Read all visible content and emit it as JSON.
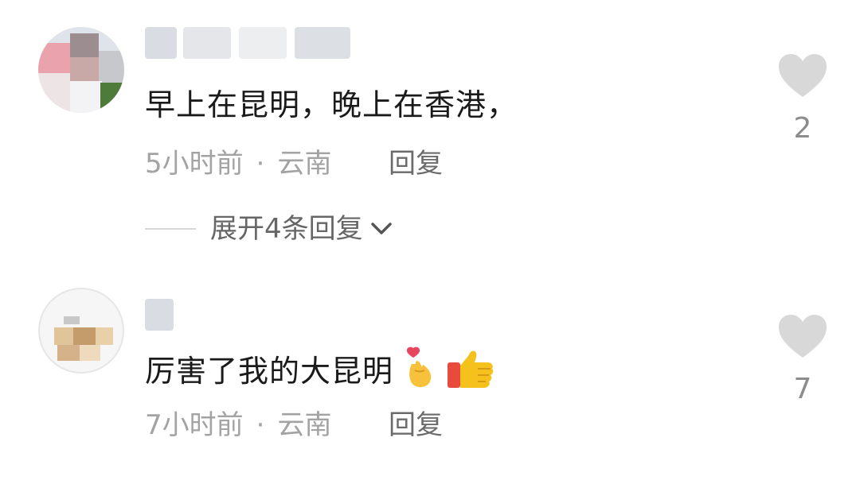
{
  "comments": [
    {
      "username": "",
      "text": "早上在昆明，晚上在香港，",
      "time": "5小时前",
      "location": "云南",
      "reply_label": "回复",
      "likes": "2",
      "expand_label": "展开4条回复"
    },
    {
      "username": "",
      "text": "厉害了我的大昆明",
      "emojis": [
        "finger-heart-emoji",
        "thumbs-up-emoji"
      ],
      "time": "7小时前",
      "location": "云南",
      "reply_label": "回复",
      "likes": "7"
    }
  ],
  "meta_separator": "·",
  "colors": {
    "text": "#1a1a1a",
    "meta": "#a3a3a3",
    "like_icon": "#d8d8d8",
    "like_count": "#8c8c8c"
  }
}
